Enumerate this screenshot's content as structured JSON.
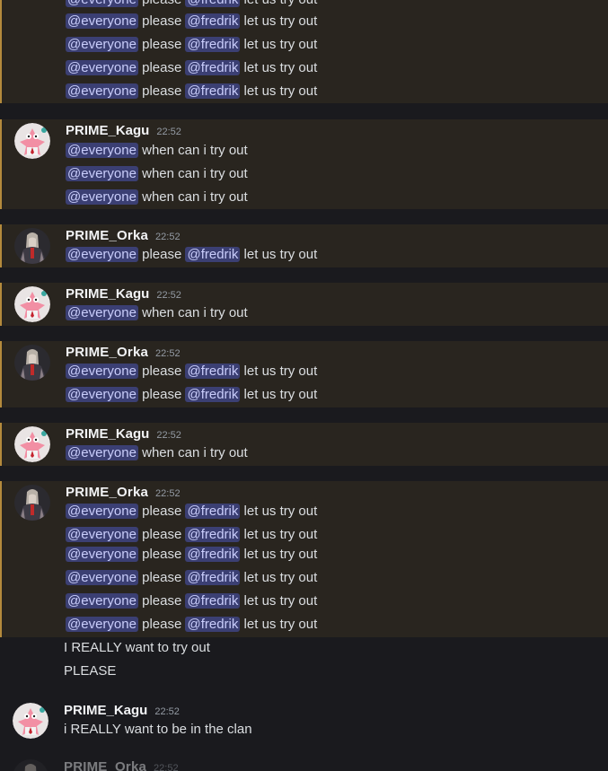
{
  "users": {
    "kagu": {
      "name": "PRIME_Kagu",
      "avatar_icon": "patrick-star-avatar-icon"
    },
    "orka": {
      "name": "PRIME_Orka",
      "avatar_icon": "dark-warrior-avatar-icon"
    }
  },
  "time": "22:52",
  "mentions": {
    "everyone": "@everyone",
    "fredrik": "@fredrik"
  },
  "phrases": {
    "please": " please ",
    "let_us_try": " let us try out",
    "when_try": " when can i try out",
    "really_try": "I REALLY want to try out",
    "please_caps": "PLEASE",
    "in_clan": "i REALLY want to be in the clan"
  },
  "colors": {
    "background": "#1a1a1e",
    "highlight_background": "#29251f",
    "highlight_border": "#b48a3c",
    "mention_background": "#3b3f73",
    "mention_text": "#c9cdfb"
  }
}
